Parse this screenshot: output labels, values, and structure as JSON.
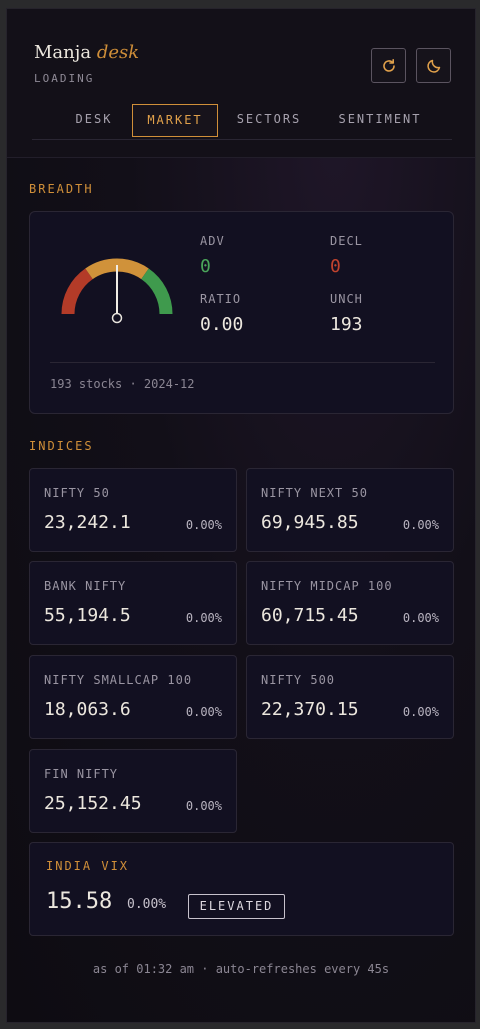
{
  "header": {
    "brand_main": "Manja",
    "brand_accent": "desk",
    "status": "LOADING",
    "refresh_icon": "refresh-icon",
    "theme_icon": "moon-icon"
  },
  "tabs": [
    {
      "label": "DESK",
      "active": false
    },
    {
      "label": "MARKET",
      "active": true
    },
    {
      "label": "SECTORS",
      "active": false
    },
    {
      "label": "SENTIMENT",
      "active": false
    }
  ],
  "breadth": {
    "title": "BREADTH",
    "adv_label": "ADV",
    "adv_value": "0",
    "decl_label": "DECL",
    "decl_value": "0",
    "ratio_label": "RATIO",
    "ratio_value": "0.00",
    "unch_label": "UNCH",
    "unch_value": "193",
    "footer": "193 stocks · 2024-12",
    "gauge_level": 0.5
  },
  "indices": {
    "title": "INDICES",
    "items": [
      {
        "name": "NIFTY 50",
        "price": "23,242.1",
        "change": "0.00%"
      },
      {
        "name": "NIFTY NEXT 50",
        "price": "69,945.85",
        "change": "0.00%"
      },
      {
        "name": "BANK NIFTY",
        "price": "55,194.5",
        "change": "0.00%"
      },
      {
        "name": "NIFTY MIDCAP 100",
        "price": "60,715.45",
        "change": "0.00%"
      },
      {
        "name": "NIFTY SMALLCAP 100",
        "price": "18,063.6",
        "change": "0.00%"
      },
      {
        "name": "NIFTY 500",
        "price": "22,370.15",
        "change": "0.00%"
      },
      {
        "name": "FIN NIFTY",
        "price": "25,152.45",
        "change": "0.00%"
      }
    ]
  },
  "vix": {
    "title": "INDIA VIX",
    "price": "15.58",
    "change": "0.00%",
    "badge": "ELEVATED"
  },
  "footer": "as of 01:32 am · auto-refreshes every 45s",
  "colors": {
    "accent": "#d08f39",
    "up": "#4aa55a",
    "down": "#c0432e",
    "gauge_red": "#b33b28",
    "gauge_amber": "#d0923a",
    "gauge_green": "#3f9a4d"
  }
}
